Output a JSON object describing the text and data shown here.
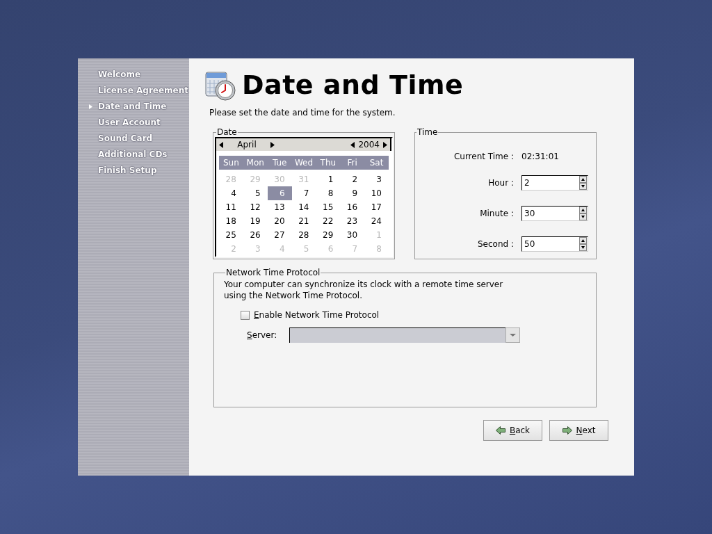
{
  "sidebar": {
    "items": [
      {
        "label": "Welcome",
        "selected": false
      },
      {
        "label": "License Agreement",
        "selected": false
      },
      {
        "label": "Date and Time",
        "selected": true
      },
      {
        "label": "User Account",
        "selected": false
      },
      {
        "label": "Sound Card",
        "selected": false
      },
      {
        "label": "Additional CDs",
        "selected": false
      },
      {
        "label": "Finish Setup",
        "selected": false
      }
    ]
  },
  "title": "Date and Time",
  "description": "Please set the date and time for the system.",
  "date": {
    "legend": "Date",
    "month": "April",
    "year": "2004",
    "weekdays": [
      "Sun",
      "Mon",
      "Tue",
      "Wed",
      "Thu",
      "Fri",
      "Sat"
    ],
    "days": [
      {
        "day": "28",
        "muted": true,
        "selected": false
      },
      {
        "day": "29",
        "muted": true,
        "selected": false
      },
      {
        "day": "30",
        "muted": true,
        "selected": false
      },
      {
        "day": "31",
        "muted": true,
        "selected": false
      },
      {
        "day": "1",
        "muted": false,
        "selected": false
      },
      {
        "day": "2",
        "muted": false,
        "selected": false
      },
      {
        "day": "3",
        "muted": false,
        "selected": false
      },
      {
        "day": "4",
        "muted": false,
        "selected": false
      },
      {
        "day": "5",
        "muted": false,
        "selected": false
      },
      {
        "day": "6",
        "muted": false,
        "selected": true
      },
      {
        "day": "7",
        "muted": false,
        "selected": false
      },
      {
        "day": "8",
        "muted": false,
        "selected": false
      },
      {
        "day": "9",
        "muted": false,
        "selected": false
      },
      {
        "day": "10",
        "muted": false,
        "selected": false
      },
      {
        "day": "11",
        "muted": false,
        "selected": false
      },
      {
        "day": "12",
        "muted": false,
        "selected": false
      },
      {
        "day": "13",
        "muted": false,
        "selected": false
      },
      {
        "day": "14",
        "muted": false,
        "selected": false
      },
      {
        "day": "15",
        "muted": false,
        "selected": false
      },
      {
        "day": "16",
        "muted": false,
        "selected": false
      },
      {
        "day": "17",
        "muted": false,
        "selected": false
      },
      {
        "day": "18",
        "muted": false,
        "selected": false
      },
      {
        "day": "19",
        "muted": false,
        "selected": false
      },
      {
        "day": "20",
        "muted": false,
        "selected": false
      },
      {
        "day": "21",
        "muted": false,
        "selected": false
      },
      {
        "day": "22",
        "muted": false,
        "selected": false
      },
      {
        "day": "23",
        "muted": false,
        "selected": false
      },
      {
        "day": "24",
        "muted": false,
        "selected": false
      },
      {
        "day": "25",
        "muted": false,
        "selected": false
      },
      {
        "day": "26",
        "muted": false,
        "selected": false
      },
      {
        "day": "27",
        "muted": false,
        "selected": false
      },
      {
        "day": "28",
        "muted": false,
        "selected": false
      },
      {
        "day": "29",
        "muted": false,
        "selected": false
      },
      {
        "day": "30",
        "muted": false,
        "selected": false
      },
      {
        "day": "1",
        "muted": true,
        "selected": false
      },
      {
        "day": "2",
        "muted": true,
        "selected": false
      },
      {
        "day": "3",
        "muted": true,
        "selected": false
      },
      {
        "day": "4",
        "muted": true,
        "selected": false
      },
      {
        "day": "5",
        "muted": true,
        "selected": false
      },
      {
        "day": "6",
        "muted": true,
        "selected": false
      },
      {
        "day": "7",
        "muted": true,
        "selected": false
      },
      {
        "day": "8",
        "muted": true,
        "selected": false
      }
    ]
  },
  "time": {
    "legend": "Time",
    "current_label": "Current Time :",
    "current_value": "02:31:01",
    "fields": [
      {
        "label": "Hour :",
        "value": "2"
      },
      {
        "label": "Minute :",
        "value": "30"
      },
      {
        "label": "Second :",
        "value": "50"
      }
    ]
  },
  "ntp": {
    "legend": "Network Time Protocol",
    "description": "Your computer can synchronize its clock with a remote time server using the Network Time Protocol.",
    "checkbox": {
      "label": "Enable Network Time Protocol",
      "checked": false
    },
    "server": {
      "label": "Server:",
      "disabled": true
    }
  },
  "buttons": [
    {
      "label": "Back",
      "kind": "back"
    },
    {
      "label": "Next",
      "kind": "next"
    }
  ]
}
